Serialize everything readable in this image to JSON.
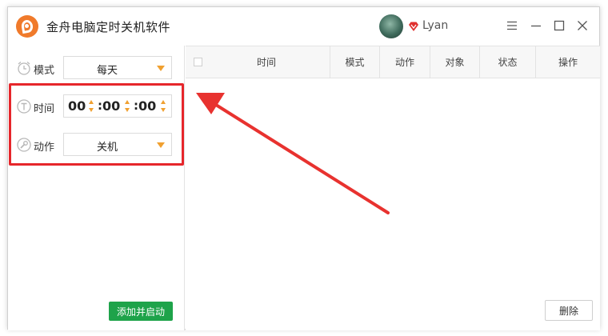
{
  "app": {
    "title": "金舟电脑定时关机软件"
  },
  "user": {
    "name": "Lyan"
  },
  "form": {
    "mode": {
      "label": "模式",
      "value": "每天"
    },
    "time": {
      "label": "时间",
      "hour": "00",
      "minute": "00",
      "second": "00",
      "separator": ":"
    },
    "action": {
      "label": "动作",
      "value": "关机"
    },
    "add_button": "添加并启动"
  },
  "table": {
    "columns": [
      "时间",
      "模式",
      "动作",
      "对象",
      "状态",
      "操作"
    ],
    "rows": []
  },
  "delete_button": "删除",
  "colors": {
    "brand": "#f07a2b",
    "accent": "#f0a030",
    "primary_button": "#1ea34a",
    "annotation": "#e6262b"
  }
}
